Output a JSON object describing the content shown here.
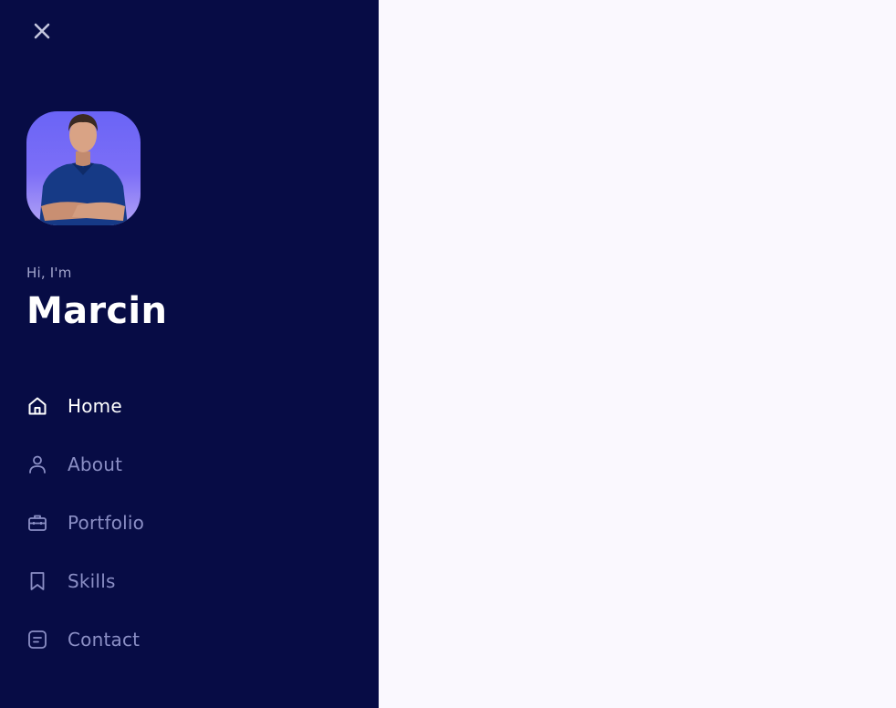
{
  "colors": {
    "sidebar_bg": "#070c45",
    "main_bg": "#faf8fe",
    "active_text": "#ffffff",
    "inactive_text": "#8b8fc5",
    "avatar_bg": "#6a64f6"
  },
  "close_icon": "close-icon",
  "profile": {
    "greeting": "Hi, I'm",
    "name": "Marcin"
  },
  "nav": {
    "items": [
      {
        "label": "Home",
        "icon": "home-icon",
        "active": true
      },
      {
        "label": "About",
        "icon": "user-icon",
        "active": false
      },
      {
        "label": "Portfolio",
        "icon": "briefcase-icon",
        "active": false
      },
      {
        "label": "Skills",
        "icon": "bookmark-icon",
        "active": false
      },
      {
        "label": "Contact",
        "icon": "message-icon",
        "active": false
      }
    ]
  }
}
